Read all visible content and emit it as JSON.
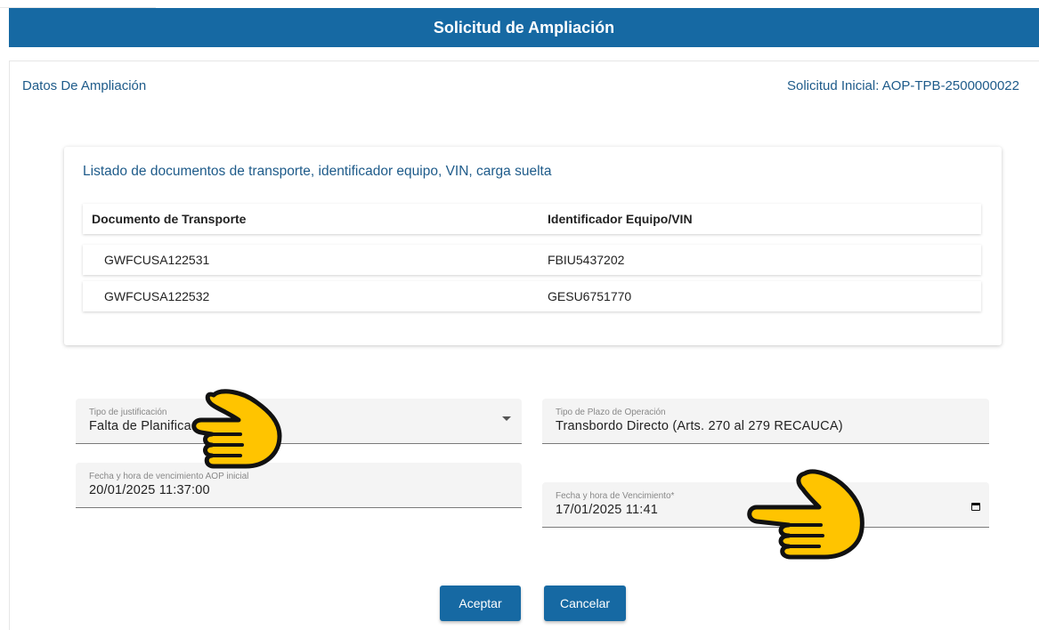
{
  "window": {
    "title": "Solicitud de Ampliación"
  },
  "header": {
    "section_title": "Datos De Ampliación",
    "initial_request": "Solicitud Inicial: AOP-TPB-2500000022"
  },
  "documents": {
    "title": "Listado de documentos de transporte, identificador equipo, VIN, carga suelta",
    "columns": [
      "Documento de Transporte",
      "Identificador Equipo/VIN"
    ],
    "rows": [
      [
        "GWFCUSA122531",
        "FBIU5437202"
      ],
      [
        "GWFCUSA122532",
        "GESU6751770"
      ]
    ]
  },
  "form": {
    "justification": {
      "label": "Tipo de justificación",
      "value": "Falta de Planificación"
    },
    "term_type": {
      "label": "Tipo de Plazo de Operación",
      "value": "Transbordo Directo (Arts. 270 al 279 RECAUCA)"
    },
    "initial_expiry": {
      "label": "Fecha y hora de vencimiento AOP inicial",
      "value": "20/01/2025 11:37:00"
    },
    "expiry": {
      "label": "Fecha y hora de Vencimiento*",
      "value": "17/01/2025 11:41"
    }
  },
  "actions": {
    "accept": "Aceptar",
    "cancel": "Cancelar"
  },
  "icons": {
    "dropdown": "chevron-down-icon",
    "calendar": "calendar-icon",
    "pointer": "pointing-hand-icon"
  },
  "colors": {
    "primary": "#1669a3",
    "heading_text": "#1e5b8a",
    "hand_fill": "#ffc400"
  }
}
